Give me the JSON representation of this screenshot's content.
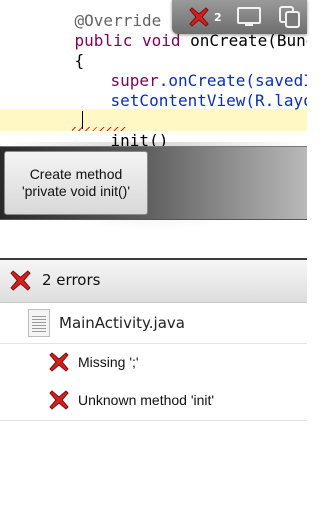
{
  "editor": {
    "lines": {
      "annotation": "@Override",
      "sig_public": "public",
      "sig_void": "void",
      "sig_rest": " onCreate(Bundle sav",
      "open_brace": "{",
      "super_kw": "super",
      "super_call": ".onCreate(savedInstan",
      "set_content": "setContentView(R.layout.ma",
      "init_call": "init()",
      "close_brace": "}"
    }
  },
  "toolbar": {
    "error_count": "2"
  },
  "quick_fix": {
    "suggestion": "Create method 'private void init()'"
  },
  "problems": {
    "header": "2 errors",
    "file": "MainActivity.java",
    "errors": [
      {
        "message": "Missing ';'"
      },
      {
        "message": "Unknown method 'init'"
      }
    ]
  },
  "icons": {
    "error": "red-x-error-icon",
    "file": "java-file-icon",
    "screen": "screen-icon",
    "copy": "copy-icon"
  },
  "colors": {
    "error_red": "#d42020",
    "keyword": "#7f0055",
    "method_call": "#0a2fb4",
    "current_line": "#fff8c4"
  }
}
